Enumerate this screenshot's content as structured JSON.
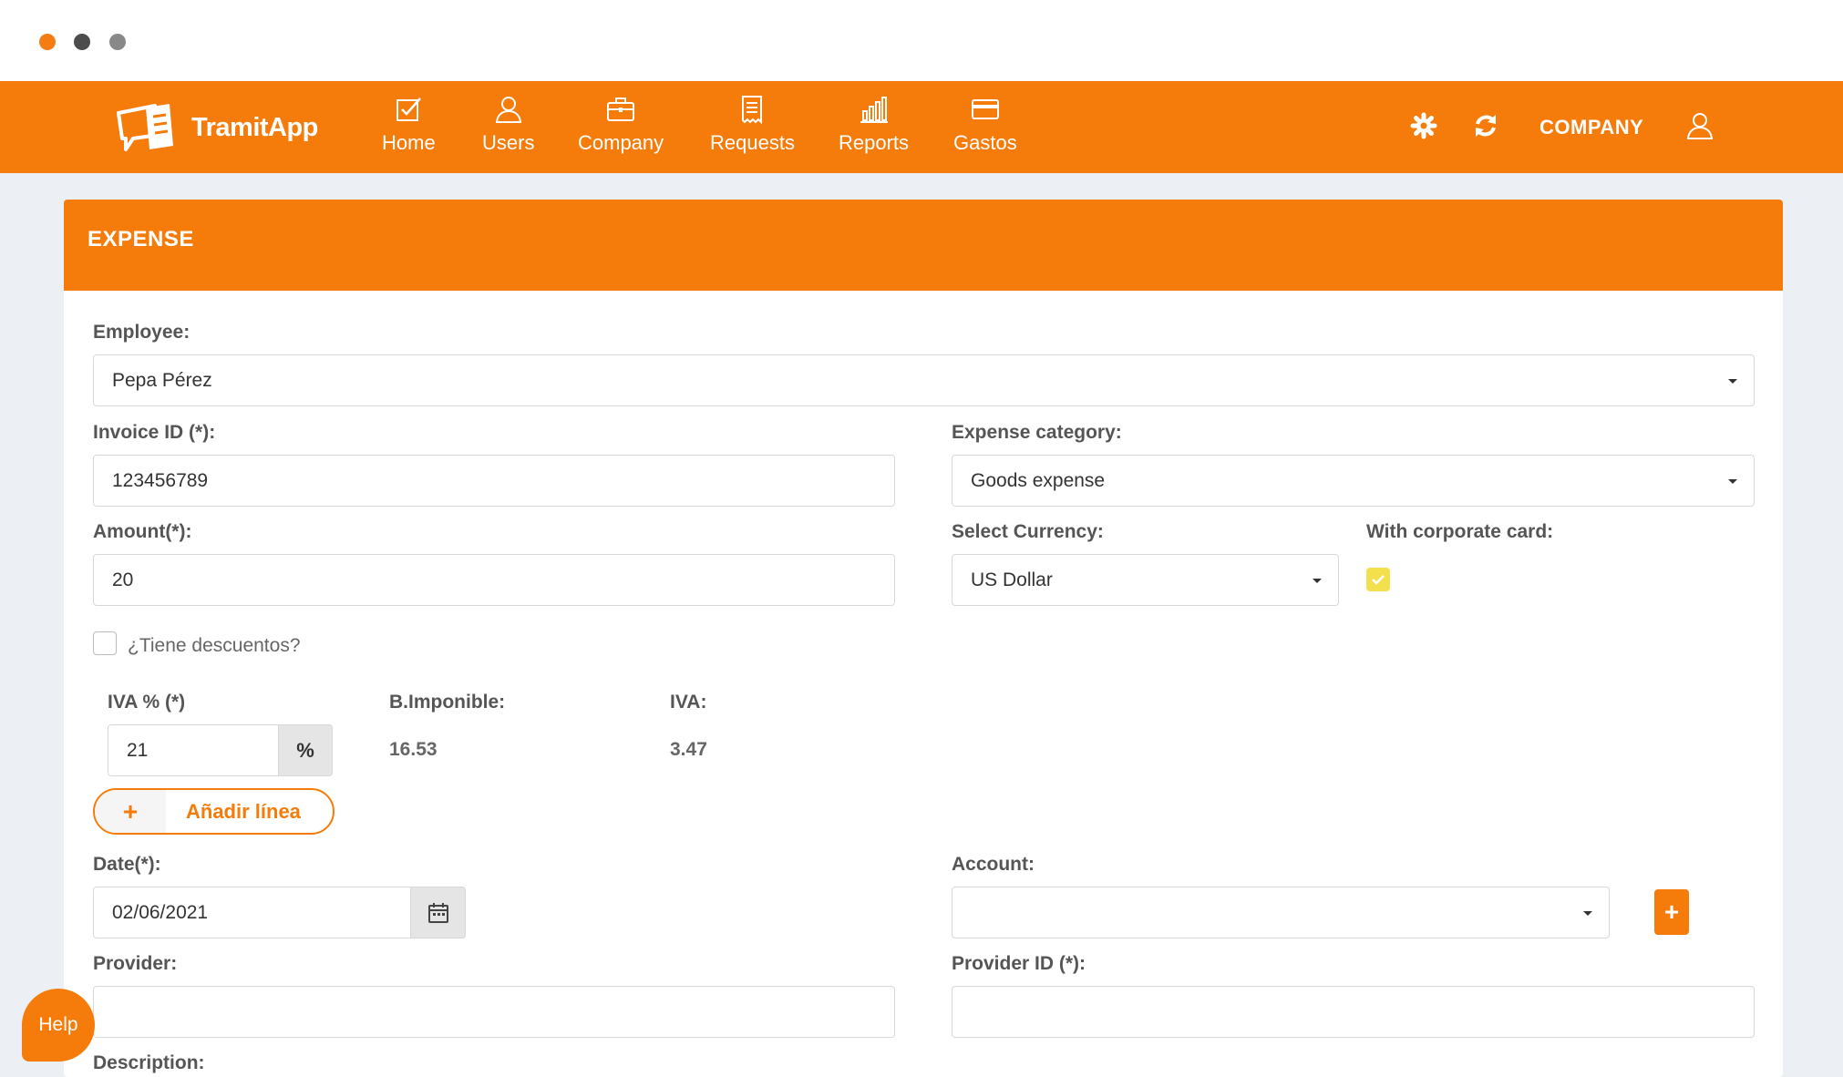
{
  "window": {
    "dots": [
      "#f37d12",
      "#4d4d4d",
      "#888888"
    ]
  },
  "brand": {
    "name": "TramitApp",
    "color": "#f57c0a"
  },
  "nav": {
    "items": [
      {
        "label": "Home",
        "icon": "check-square-icon"
      },
      {
        "label": "Users",
        "icon": "user-icon"
      },
      {
        "label": "Company",
        "icon": "briefcase-icon"
      },
      {
        "label": "Requests",
        "icon": "receipt-icon"
      },
      {
        "label": "Reports",
        "icon": "bar-chart-icon"
      },
      {
        "label": "Gastos",
        "icon": "credit-card-icon"
      }
    ],
    "tools": [
      "gear-icon",
      "refresh-icon"
    ],
    "company_label": "COMPANY",
    "profile_icon": "user-icon"
  },
  "panel": {
    "title": "EXPENSE",
    "employee": {
      "label": "Employee:",
      "value": "Pepa Pérez"
    },
    "invoice_id": {
      "label": "Invoice ID (*):",
      "value": "123456789"
    },
    "expense_category": {
      "label": "Expense category:",
      "value": "Goods expense"
    },
    "amount": {
      "label": "Amount(*):",
      "value": "20"
    },
    "currency": {
      "label": "Select Currency:",
      "value": "US Dollar"
    },
    "corporate_card": {
      "label": "With corporate card:",
      "checked": true
    },
    "discounts": {
      "label": "¿Tiene descuentos?",
      "checked": false
    },
    "iva_pct": {
      "label": "IVA % (*)",
      "value": "21",
      "suffix": "%"
    },
    "base": {
      "label": "B.Imponible:",
      "value": "16.53"
    },
    "iva": {
      "label": "IVA:",
      "value": "3.47"
    },
    "add_line": {
      "label": "Añadir línea",
      "icon": "plus-icon"
    },
    "date": {
      "label": "Date(*):",
      "value": "02/06/2021",
      "icon": "calendar-icon"
    },
    "account": {
      "label": "Account:",
      "value": "",
      "add_icon": "plus-icon"
    },
    "provider": {
      "label": "Provider:",
      "value": ""
    },
    "provider_id": {
      "label": "Provider ID (*):",
      "value": ""
    },
    "description": {
      "label": "Description:"
    }
  },
  "help": {
    "label": "Help"
  }
}
